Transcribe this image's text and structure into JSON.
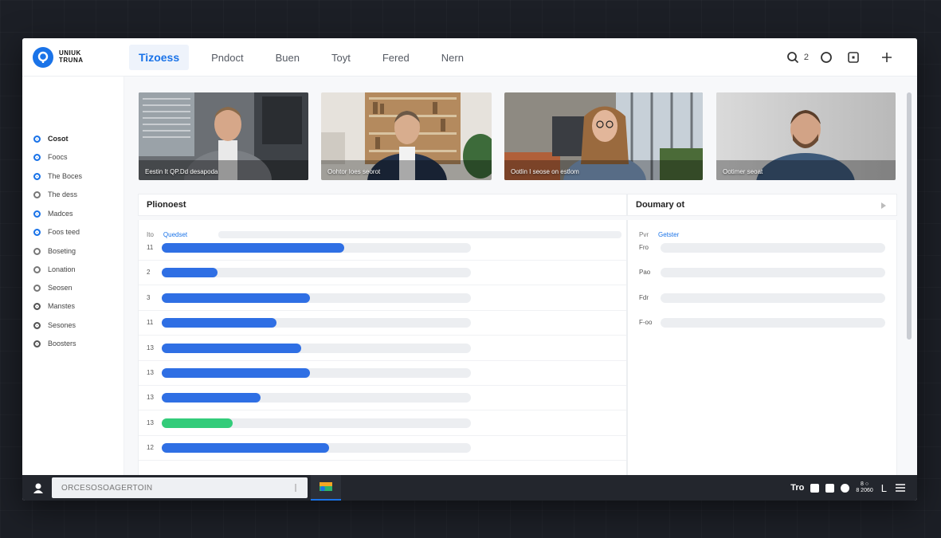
{
  "app": {
    "logo_text": "UNIUK TRUNA",
    "accent": "#1a73e8"
  },
  "tabs": [
    {
      "label": "Tizoess",
      "active": true
    },
    {
      "label": "Pndoct"
    },
    {
      "label": "Buen"
    },
    {
      "label": "Toyt"
    },
    {
      "label": "Fered"
    },
    {
      "label": "Nern"
    }
  ],
  "top_actions": {
    "count": "2",
    "icons": [
      "search-icon",
      "circle-icon",
      "square-icon",
      "plus-icon"
    ]
  },
  "sidebar": {
    "items": [
      {
        "label": "Cosot",
        "dot": "blue",
        "active": true
      },
      {
        "label": "Foocs",
        "dot": "blue"
      },
      {
        "label": "The Boces",
        "dot": "blue"
      },
      {
        "label": "The dess",
        "dot": "grey"
      },
      {
        "label": "Madces",
        "dot": "blue"
      },
      {
        "label": "Foos teed",
        "dot": "blue"
      },
      {
        "label": "Boseting",
        "dot": "grey"
      },
      {
        "label": "Lonation",
        "dot": "grey"
      },
      {
        "label": "Seosen",
        "dot": "grey"
      },
      {
        "label": "Manstes",
        "dot": "dark"
      },
      {
        "label": "Sesones",
        "dot": "dark"
      },
      {
        "label": "Boosters",
        "dot": "dark"
      }
    ]
  },
  "videos": [
    {
      "caption": "Eestin It QP.Dd desapoda"
    },
    {
      "caption": "Oohtor Ioes seorot"
    },
    {
      "caption": "Ootlin I seose on estlom"
    },
    {
      "caption": "Ootimer seoat"
    }
  ],
  "left_panel": {
    "title": "Plionoest",
    "col_a": "Ito",
    "col_b": "Quedset",
    "rows": [
      {
        "num": "11",
        "value": 0.59,
        "color": "#2f6fe4"
      },
      {
        "num": "2",
        "value": 0.18,
        "color": "#2f6fe4"
      },
      {
        "num": "3",
        "value": 0.48,
        "color": "#2f6fe4"
      },
      {
        "num": "11",
        "value": 0.37,
        "color": "#2f6fe4"
      },
      {
        "num": "13",
        "value": 0.45,
        "color": "#2f6fe4"
      },
      {
        "num": "13",
        "value": 0.48,
        "color": "#2f6fe4"
      },
      {
        "num": "13",
        "value": 0.32,
        "color": "#2f6fe4"
      },
      {
        "num": "13",
        "value": 0.23,
        "color": "#33cc7a"
      },
      {
        "num": "12",
        "value": 0.54,
        "color": "#2f6fe4"
      }
    ]
  },
  "right_panel": {
    "title": "Doumary ot",
    "col_a": "Pvr",
    "col_b": "Getster",
    "rows": [
      {
        "label": "Fro"
      },
      {
        "label": "Pao"
      },
      {
        "label": "Fdr"
      },
      {
        "label": "F-oo"
      }
    ]
  },
  "taskbar": {
    "search_text": "ORCESOSOAGERTOIN",
    "tray_text": "Tro",
    "clock_line1": "8  ○",
    "clock_line2": "8 2060",
    "tray_letter": "L"
  }
}
